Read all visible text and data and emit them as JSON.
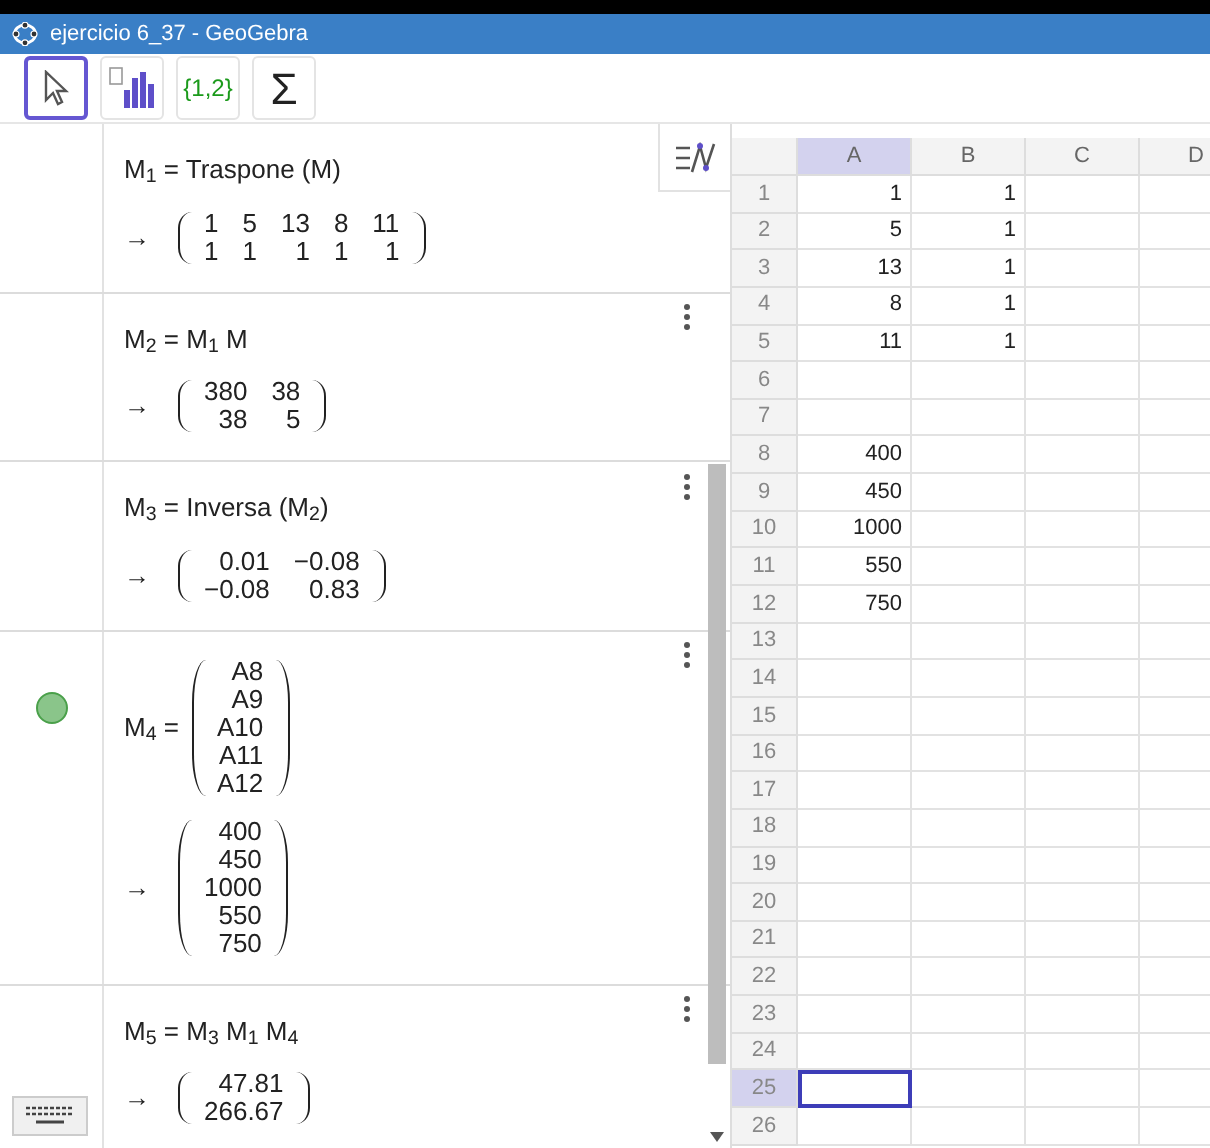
{
  "window": {
    "title": "ejercicio 6_37 - GeoGebra"
  },
  "toolbar": [
    {
      "kind": "pointer",
      "selected": true
    },
    {
      "kind": "chart",
      "selected": false
    },
    {
      "kind": "text",
      "label": "{1,2}",
      "selected": false
    },
    {
      "kind": "text",
      "label": "Σ",
      "selected": false
    }
  ],
  "algebra": [
    {
      "definition": "M$_{1}$ = Traspone (M)",
      "arrow": "→",
      "result": [
        [
          "1",
          "5",
          "13",
          "8",
          "11"
        ],
        [
          "1",
          "1",
          "1",
          "1",
          "1"
        ]
      ],
      "shown": false,
      "menu": false
    },
    {
      "definition": "M$_{2}$ = M$_{1}$ M",
      "arrow": "→",
      "result": [
        [
          "380",
          "38"
        ],
        [
          "38",
          "5"
        ]
      ],
      "shown": false,
      "menu": true
    },
    {
      "definition": "M$_{3}$ = Inversa (M$_{2}$)",
      "arrow": "→",
      "result": [
        [
          "0.01",
          "−0.08"
        ],
        [
          "−0.08",
          "0.83"
        ]
      ],
      "shown": false,
      "menu": true
    },
    {
      "definition": "M$_{4}$ =",
      "definition_matrix": [
        [
          "A8"
        ],
        [
          "A9"
        ],
        [
          "A10"
        ],
        [
          "A11"
        ],
        [
          "A12"
        ]
      ],
      "arrow": "→",
      "result": [
        [
          "400"
        ],
        [
          "450"
        ],
        [
          "1000"
        ],
        [
          "550"
        ],
        [
          "750"
        ]
      ],
      "shown": true,
      "menu": true
    },
    {
      "definition": "M$_{5}$ = M$_{3}$ M$_{1}$ M$_{4}$",
      "arrow": "→",
      "result": [
        [
          "47.81"
        ],
        [
          "266.67"
        ]
      ],
      "shown": false,
      "menu": true
    }
  ],
  "spreadsheet": {
    "columns": [
      {
        "label": "A",
        "selected": true
      },
      {
        "label": "B",
        "selected": false
      },
      {
        "label": "C",
        "selected": false
      },
      {
        "label": "D",
        "selected": false
      }
    ],
    "rows": [
      {
        "label": "1",
        "cells": [
          "1",
          "1"
        ],
        "selected": false
      },
      {
        "label": "2",
        "cells": [
          "5",
          "1"
        ],
        "selected": false
      },
      {
        "label": "3",
        "cells": [
          "13",
          "1"
        ],
        "selected": false
      },
      {
        "label": "4",
        "cells": [
          "8",
          "1"
        ],
        "selected": false
      },
      {
        "label": "5",
        "cells": [
          "11",
          "1"
        ],
        "selected": false
      },
      {
        "label": "6",
        "selected": false
      },
      {
        "label": "7",
        "selected": false
      },
      {
        "label": "8",
        "cells": [
          "400"
        ],
        "selected": false
      },
      {
        "label": "9",
        "cells": [
          "450"
        ],
        "selected": false
      },
      {
        "label": "10",
        "cells": [
          "1000"
        ],
        "selected": false
      },
      {
        "label": "11",
        "cells": [
          "550"
        ],
        "selected": false
      },
      {
        "label": "12",
        "cells": [
          "750"
        ],
        "selected": false
      },
      {
        "label": "13",
        "selected": false
      },
      {
        "label": "14",
        "selected": false
      },
      {
        "label": "15",
        "selected": false
      },
      {
        "label": "16",
        "selected": false
      },
      {
        "label": "17",
        "selected": false
      },
      {
        "label": "18",
        "selected": false
      },
      {
        "label": "19",
        "selected": false
      },
      {
        "label": "20",
        "selected": false
      },
      {
        "label": "21",
        "selected": false
      },
      {
        "label": "22",
        "selected": false
      },
      {
        "label": "23",
        "selected": false
      },
      {
        "label": "24",
        "selected": false
      },
      {
        "label": "25",
        "selected": true
      },
      {
        "label": "26",
        "selected": false
      }
    ]
  }
}
